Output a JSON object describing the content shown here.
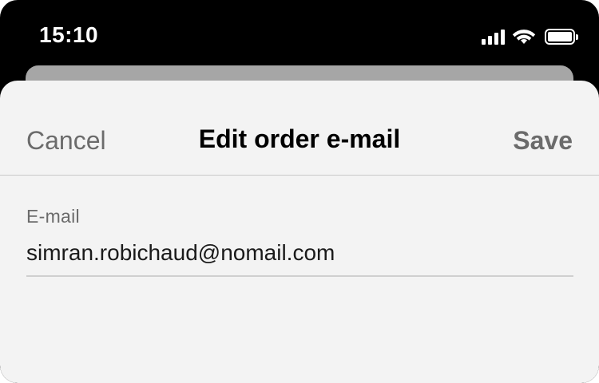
{
  "status_bar": {
    "time": "15:10",
    "icons": [
      "cellular-signal-icon",
      "wifi-icon",
      "battery-icon"
    ],
    "battery_level": 1.0
  },
  "sheet": {
    "cancel_label": "Cancel",
    "title": "Edit order e-mail",
    "save_label": "Save",
    "email_field": {
      "label": "E-mail",
      "value": "simran.robichaud@nomail.com"
    }
  },
  "colors": {
    "background": "#000000",
    "sheet_background": "#f3f3f3",
    "secondary_text": "#6b6b6b",
    "primary_text": "#000000"
  }
}
